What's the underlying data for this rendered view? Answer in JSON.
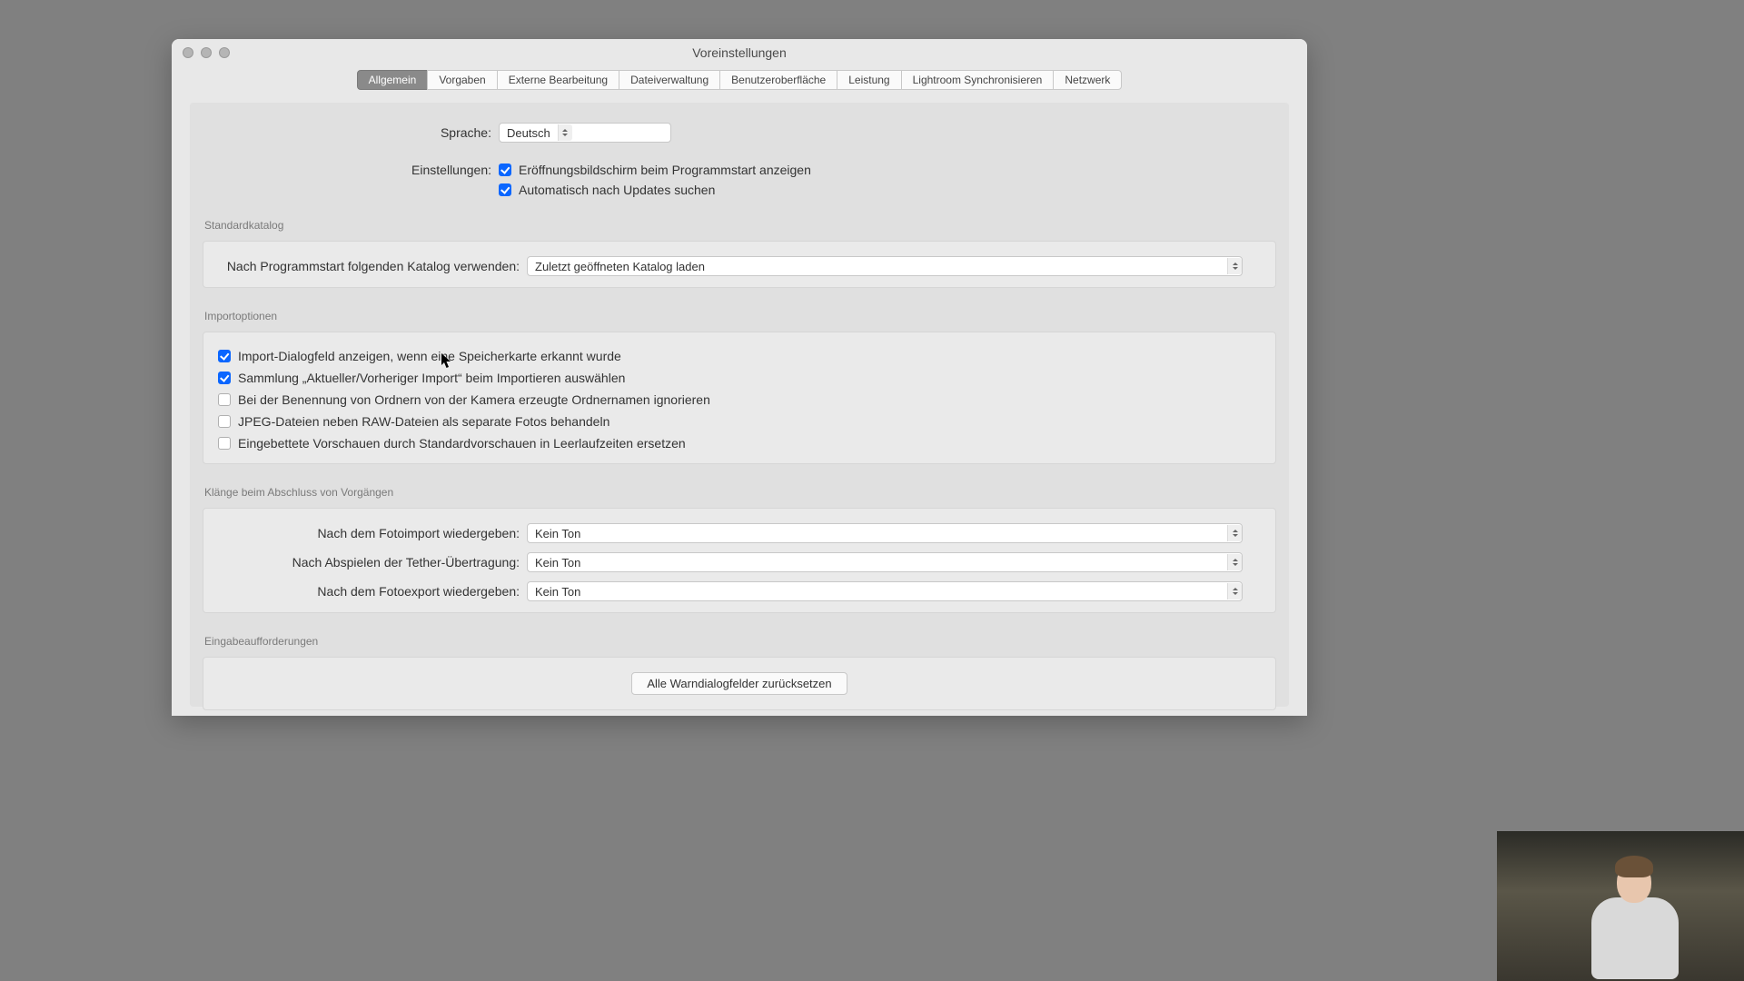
{
  "window": {
    "title": "Voreinstellungen"
  },
  "tabs": [
    "Allgemein",
    "Vorgaben",
    "Externe Bearbeitung",
    "Dateiverwaltung",
    "Benutzeroberfläche",
    "Leistung",
    "Lightroom Synchronisieren",
    "Netzwerk"
  ],
  "active_tab_index": 0,
  "language": {
    "label": "Sprache:",
    "value": "Deutsch"
  },
  "settings_label": "Einstellungen:",
  "settings_checks": [
    {
      "checked": true,
      "label": "Eröffnungsbildschirm beim Programmstart anzeigen"
    },
    {
      "checked": true,
      "label": "Automatisch nach Updates suchen"
    }
  ],
  "catalog": {
    "section": "Standardkatalog",
    "label": "Nach Programmstart folgenden Katalog verwenden:",
    "value": "Zuletzt geöffneten Katalog laden"
  },
  "import": {
    "section": "Importoptionen",
    "checks": [
      {
        "checked": true,
        "label": "Import-Dialogfeld anzeigen, wenn eine Speicherkarte erkannt wurde"
      },
      {
        "checked": true,
        "label": "Sammlung „Aktueller/Vorheriger Import“ beim Importieren auswählen"
      },
      {
        "checked": false,
        "label": "Bei der Benennung von Ordnern von der Kamera erzeugte Ordnernamen ignorieren"
      },
      {
        "checked": false,
        "label": "JPEG-Dateien neben RAW-Dateien als separate Fotos behandeln"
      },
      {
        "checked": false,
        "label": "Eingebettete Vorschauen durch Standardvorschauen in Leerlaufzeiten ersetzen"
      }
    ]
  },
  "sounds": {
    "section": "Klänge beim Abschluss von Vorgängen",
    "rows": [
      {
        "label": "Nach dem Fotoimport wiedergeben:",
        "value": "Kein Ton"
      },
      {
        "label": "Nach Abspielen der Tether-Übertragung:",
        "value": "Kein Ton"
      },
      {
        "label": "Nach dem Fotoexport wiedergeben:",
        "value": "Kein Ton"
      }
    ]
  },
  "prompts": {
    "section": "Eingabeaufforderungen",
    "button": "Alle Warndialogfelder zurücksetzen"
  }
}
